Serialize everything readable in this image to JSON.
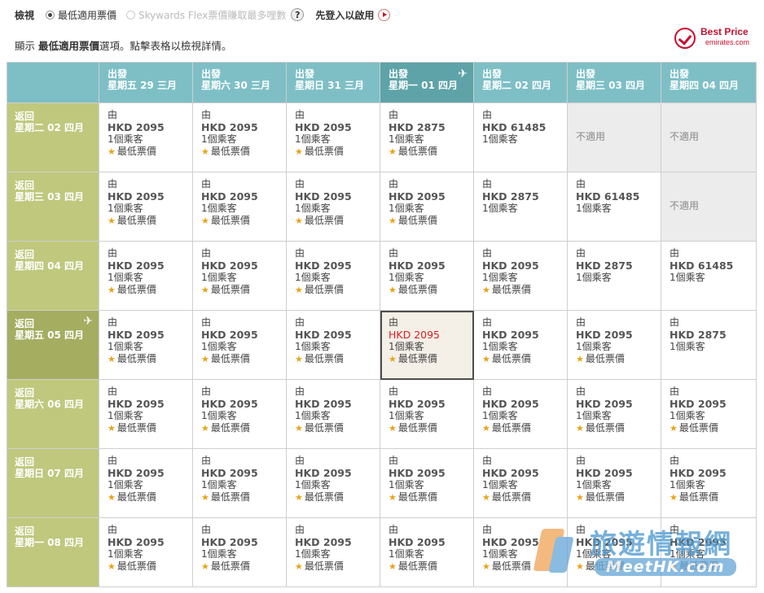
{
  "view": {
    "label": "檢視",
    "option_lowest": "最低適用票價",
    "option_skywards": "Skywards Flex票價賺取最多哩數",
    "help": "?",
    "login": "先登入以啟用"
  },
  "hint": {
    "prefix": "顯示 ",
    "bold": "最低適用票價",
    "suffix": "選項。點擊表格以檢視詳情。"
  },
  "best_price": {
    "title": "Best Price",
    "site": "emirates.com"
  },
  "departures": [
    {
      "label": "出發",
      "date": "星期五 29 三月"
    },
    {
      "label": "出發",
      "date": "星期六 30 三月"
    },
    {
      "label": "出發",
      "date": "星期日 31 三月"
    },
    {
      "label": "出發",
      "date": "星期一 01 四月"
    },
    {
      "label": "出發",
      "date": "星期二 02 四月"
    },
    {
      "label": "出發",
      "date": "星期三 03 四月"
    },
    {
      "label": "出發",
      "date": "星期四 04 四月"
    }
  ],
  "returns": [
    {
      "label": "返回",
      "date": "星期二 02 四月"
    },
    {
      "label": "返回",
      "date": "星期三 03 四月"
    },
    {
      "label": "返回",
      "date": "星期四 04 四月"
    },
    {
      "label": "返回",
      "date": "星期五 05 四月"
    },
    {
      "label": "返回",
      "date": "星期六 06 四月"
    },
    {
      "label": "返回",
      "date": "星期日 07 四月"
    },
    {
      "label": "返回",
      "date": "星期一 08 四月"
    }
  ],
  "selected_departure": 3,
  "selected_return": 3,
  "cell_text": {
    "from": "由",
    "pax": "1個乘客",
    "best": "最低票價",
    "na": "不適用"
  },
  "prices": [
    [
      "HKD 2095",
      "HKD 2095",
      "HKD 2095",
      "HKD 2875",
      "HKD 61485",
      null,
      null
    ],
    [
      "HKD 2095",
      "HKD 2095",
      "HKD 2095",
      "HKD 2095",
      "HKD 2875",
      "HKD 61485",
      null
    ],
    [
      "HKD 2095",
      "HKD 2095",
      "HKD 2095",
      "HKD 2095",
      "HKD 2095",
      "HKD 2875",
      "HKD 61485"
    ],
    [
      "HKD 2095",
      "HKD 2095",
      "HKD 2095",
      "HKD 2095",
      "HKD 2095",
      "HKD 2095",
      "HKD 2875"
    ],
    [
      "HKD 2095",
      "HKD 2095",
      "HKD 2095",
      "HKD 2095",
      "HKD 2095",
      "HKD 2095",
      "HKD 2095"
    ],
    [
      "HKD 2095",
      "HKD 2095",
      "HKD 2095",
      "HKD 2095",
      "HKD 2095",
      "HKD 2095",
      "HKD 2095"
    ],
    [
      "HKD 2095",
      "HKD 2095",
      "HKD 2095",
      "HKD 2095",
      "HKD 2095",
      "HKD 2095",
      "HKD 2095"
    ]
  ],
  "best_flags": [
    [
      true,
      true,
      true,
      true,
      false,
      false,
      false
    ],
    [
      true,
      true,
      true,
      true,
      false,
      false,
      false
    ],
    [
      true,
      true,
      true,
      true,
      true,
      false,
      false
    ],
    [
      true,
      true,
      true,
      true,
      true,
      true,
      false
    ],
    [
      true,
      true,
      true,
      true,
      true,
      true,
      true
    ],
    [
      true,
      true,
      true,
      true,
      true,
      true,
      true
    ],
    [
      true,
      true,
      true,
      true,
      true,
      true,
      true
    ]
  ],
  "watermark": {
    "cn": "旅遊情報網",
    "en": "MeetHK.com"
  }
}
